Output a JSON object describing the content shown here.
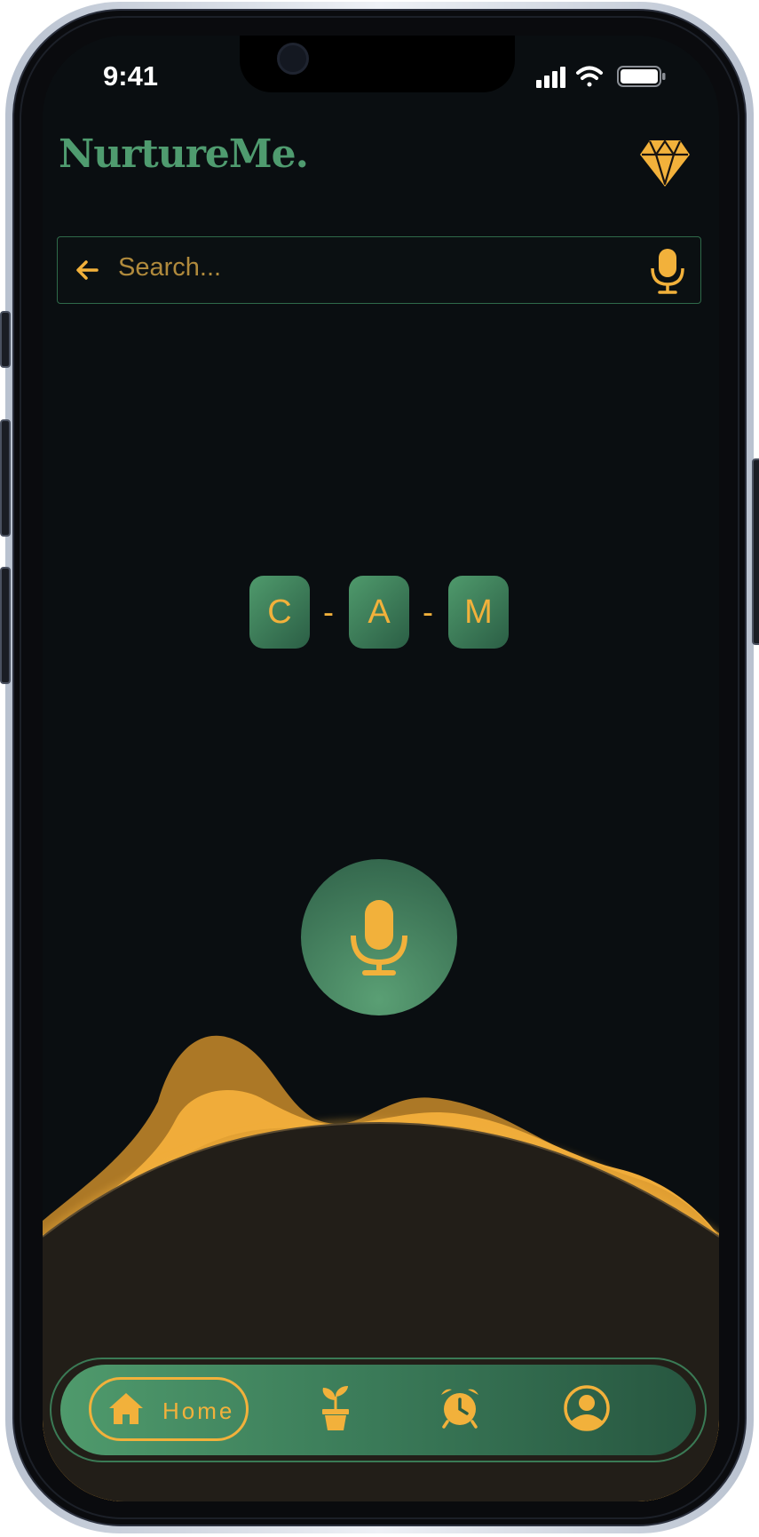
{
  "status_bar": {
    "time": "9:41"
  },
  "header": {
    "app_name": "NurtureMe."
  },
  "search": {
    "placeholder": "Search..."
  },
  "code": {
    "letters": [
      "C",
      "A",
      "M"
    ],
    "separator": "-"
  },
  "nav": {
    "home_label": "Home",
    "items": [
      "home-icon",
      "plant-icon",
      "alarm-icon",
      "profile-icon"
    ]
  },
  "colors": {
    "accent": "#f2b13b",
    "brand_green": "#4f9b6f",
    "background": "#0a0e11"
  }
}
